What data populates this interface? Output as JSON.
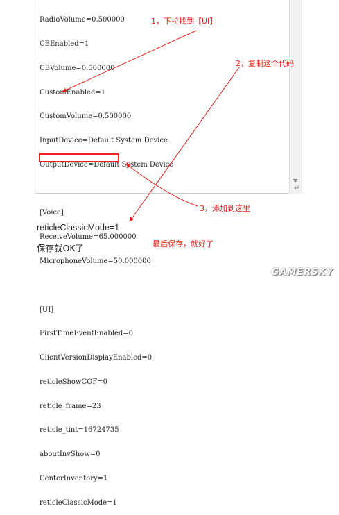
{
  "editor": {
    "lines": [
      "RadioVolume=0.500000",
      "CBEnabled=1",
      "CBVolume=0.500000",
      "CustomEnabled=1",
      "CustomVolume=0.500000",
      "InputDevice=Default System Device",
      "OutputDevice=Default System Device",
      "",
      "[Voice]",
      "ReceiveVolume=65.000000",
      "MicrophoneVolume=50.000000",
      "",
      "[UI]",
      "FirstTimeEventEnabled=0",
      "ClientVersionDisplayEnabled=0",
      "reticleShowCOF=0",
      "reticle_frame=23",
      "reticle_tint=16724735",
      "aboutInvShow=0",
      "CenterInventory=1",
      "reticleClassicMode=1"
    ]
  },
  "annotations": {
    "step1": "1，下拉找到【UI】",
    "step2": "2，复制这个代码",
    "step3": "3，添加到这里",
    "final": "最后保存，就好了"
  },
  "body_text": {
    "code_line": "reticleClassicMode=1",
    "save_note": "保存就OK了"
  },
  "watermark": "GAMERSKY",
  "colors": {
    "annotation": "#e0211c",
    "highlight_border": "#e22"
  }
}
